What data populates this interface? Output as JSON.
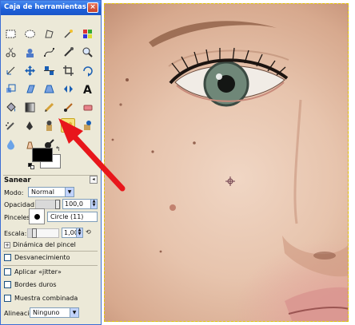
{
  "window": {
    "title": "Caja de herramientas",
    "close_glyph": "×"
  },
  "tools": [
    {
      "name": "rect-select-icon"
    },
    {
      "name": "ellipse-select-icon"
    },
    {
      "name": "free-select-icon"
    },
    {
      "name": "fuzzy-select-icon"
    },
    {
      "name": "color-select-icon"
    },
    {
      "name": "scissors-icon"
    },
    {
      "name": "foreground-select-icon"
    },
    {
      "name": "paths-icon"
    },
    {
      "name": "color-picker-icon"
    },
    {
      "name": "zoom-icon"
    },
    {
      "name": "measure-icon"
    },
    {
      "name": "move-icon"
    },
    {
      "name": "align-icon"
    },
    {
      "name": "crop-icon"
    },
    {
      "name": "rotate-icon"
    },
    {
      "name": "scale-icon"
    },
    {
      "name": "shear-icon"
    },
    {
      "name": "perspective-icon"
    },
    {
      "name": "flip-icon"
    },
    {
      "name": "text-icon"
    },
    {
      "name": "bucket-fill-icon"
    },
    {
      "name": "blend-icon"
    },
    {
      "name": "pencil-icon"
    },
    {
      "name": "paintbrush-icon"
    },
    {
      "name": "eraser-icon"
    },
    {
      "name": "airbrush-icon"
    },
    {
      "name": "ink-icon"
    },
    {
      "name": "clone-icon"
    },
    {
      "name": "heal-icon",
      "active": true
    },
    {
      "name": "perspective-clone-icon"
    },
    {
      "name": "blur-sharpen-icon"
    },
    {
      "name": "smudge-icon"
    },
    {
      "name": "dodge-burn-icon"
    }
  ],
  "colors": {
    "foreground": "#000000",
    "background": "#ffffff",
    "swap_glyph": "↰"
  },
  "options": {
    "title": "Sanear",
    "mode_label": "Modo:",
    "mode_value": "Normal",
    "opacity_label": "Opacidad:",
    "opacity_value": "100,0",
    "opacity_fraction": 1.0,
    "brush_label": "Pinceles:",
    "brush_value": "Circle (11)",
    "scale_label": "Escala:",
    "scale_value": "1,00",
    "scale_fraction": 0.15,
    "brush_dynamics_label": "Dinámica del pincel",
    "expander_glyph": "+",
    "checkboxes": {
      "fade": "Desvanecimiento",
      "jitter": "Aplicar «jitter»",
      "hard_edges": "Bordes duros",
      "sample_merged": "Muestra combinada"
    },
    "alignment_label": "Alineación:",
    "alignment_value": "Ninguno",
    "menu_glyph": "◂",
    "dropdown_glyph": "▼"
  },
  "accent": {
    "titlebar": "#1d5fd8",
    "annotation_arrow": "#e8161b",
    "selection_border": "#e0c400"
  }
}
